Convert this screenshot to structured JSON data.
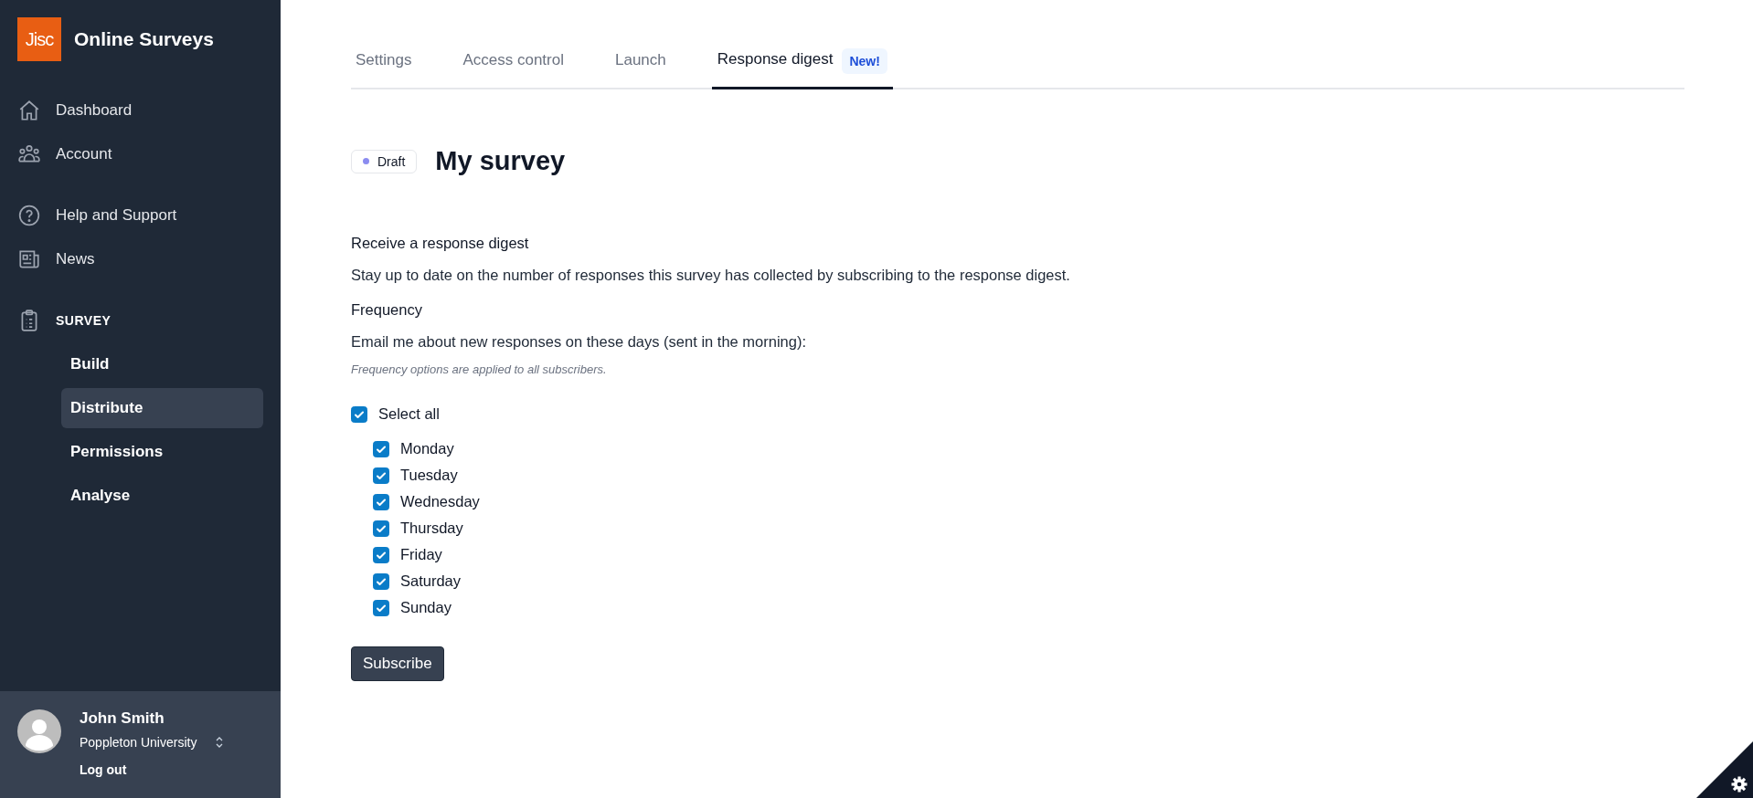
{
  "brand": {
    "logo": "Jisc",
    "name": "Online Surveys"
  },
  "sidebar": {
    "main_items": [
      {
        "label": "Dashboard",
        "selected": false
      },
      {
        "label": "Account",
        "selected": false
      }
    ],
    "support_items": [
      {
        "label": "Help and Support",
        "selected": false
      },
      {
        "label": "News",
        "selected": false
      }
    ],
    "section": {
      "label": "SURVEY",
      "items": [
        {
          "label": "Build",
          "selected": false
        },
        {
          "label": "Distribute",
          "selected": true
        },
        {
          "label": "Permissions",
          "selected": false
        },
        {
          "label": "Analyse",
          "selected": false
        }
      ]
    }
  },
  "user": {
    "name": "John Smith",
    "organisation": "Poppleton University",
    "logout": "Log out"
  },
  "tabs": [
    {
      "label": "Settings",
      "selected": false
    },
    {
      "label": "Access control",
      "selected": false
    },
    {
      "label": "Launch",
      "selected": false
    },
    {
      "label": "Response digest",
      "selected": true,
      "badge": "New!"
    }
  ],
  "survey": {
    "status": "Draft",
    "title": "My survey"
  },
  "digest": {
    "heading": "Receive a response digest",
    "description": "Stay up to date on the number of responses this survey has collected by subscribing to the response digest.",
    "frequency_heading": "Frequency",
    "frequency_prompt": "Email me about new responses on these days (sent in the morning):",
    "note": "Frequency options are applied to all subscribers.",
    "select_all": {
      "label": "Select all",
      "checked": true
    },
    "days": [
      {
        "label": "Monday",
        "checked": true
      },
      {
        "label": "Tuesday",
        "checked": true
      },
      {
        "label": "Wednesday",
        "checked": true
      },
      {
        "label": "Thursday",
        "checked": true
      },
      {
        "label": "Friday",
        "checked": true
      },
      {
        "label": "Saturday",
        "checked": true
      },
      {
        "label": "Sunday",
        "checked": true
      }
    ],
    "button": "Subscribe"
  }
}
